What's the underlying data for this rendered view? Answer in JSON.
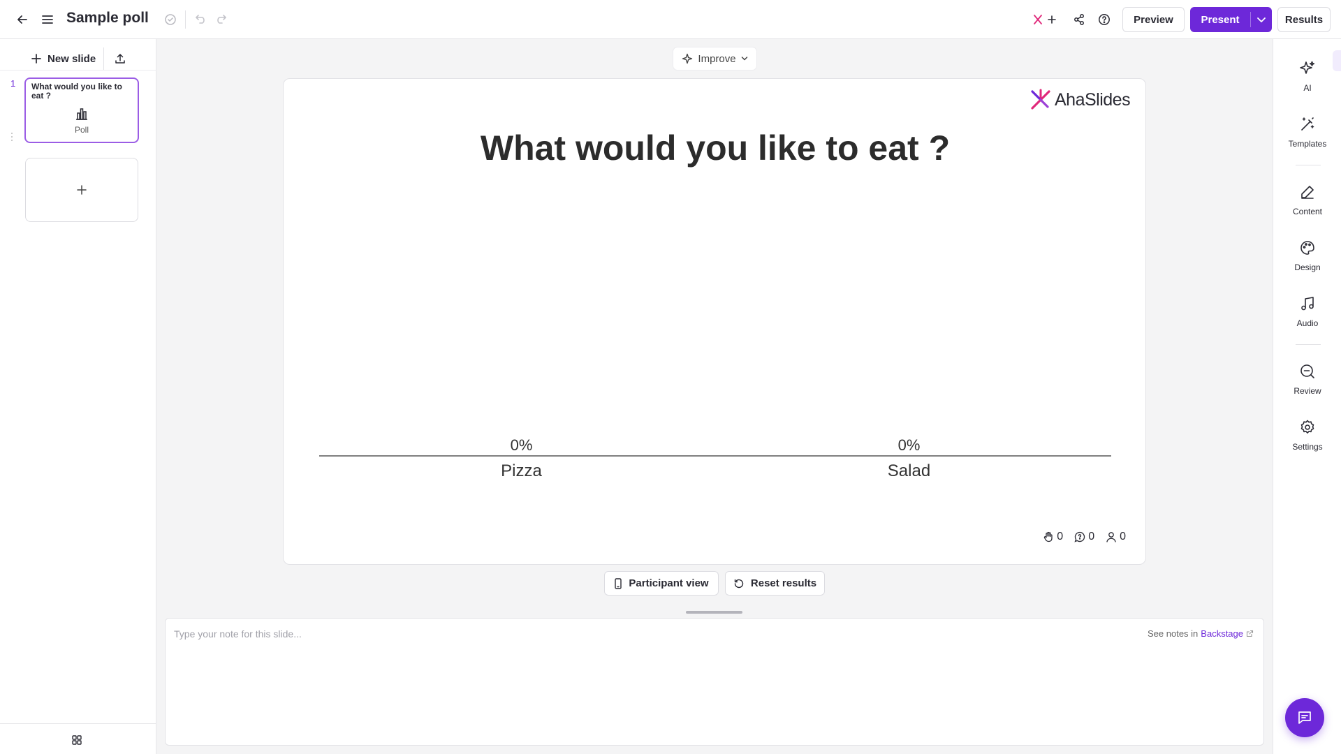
{
  "header": {
    "title": "Sample poll",
    "preview_label": "Preview",
    "present_label": "Present",
    "results_label": "Results"
  },
  "sidebar": {
    "new_slide_label": "New slide",
    "slides": [
      {
        "number": "1",
        "title": "What would you like to eat ?",
        "type": "Poll"
      }
    ]
  },
  "toolbar": {
    "improve_label": "Improve"
  },
  "slide": {
    "brand": "AhaSlides",
    "question": "What would you like to eat ?",
    "counters": {
      "reactions": "0",
      "questions": "0",
      "participants": "0"
    }
  },
  "chart_data": {
    "type": "bar",
    "categories": [
      "Pizza",
      "Salad"
    ],
    "values": [
      0,
      0
    ],
    "value_labels": [
      "0%",
      "0%"
    ],
    "unit": "%",
    "ylim": [
      0,
      100
    ],
    "grid": false
  },
  "actions": {
    "participant_view_label": "Participant view",
    "reset_results_label": "Reset results"
  },
  "notes": {
    "placeholder": "Type your note for this slide...",
    "see_notes_prefix": "See notes in",
    "backstage_link": "Backstage"
  },
  "right_panel": {
    "items": [
      {
        "label": "AI",
        "icon": "sparkle-icon"
      },
      {
        "label": "Templates",
        "icon": "magic-wand-icon"
      },
      {
        "label": "Content",
        "icon": "pencil-icon"
      },
      {
        "label": "Design",
        "icon": "palette-icon"
      },
      {
        "label": "Audio",
        "icon": "music-note-icon"
      },
      {
        "label": "Review",
        "icon": "review-search-icon"
      },
      {
        "label": "Settings",
        "icon": "gear-icon"
      }
    ]
  },
  "colors": {
    "accent": "#6d28d9",
    "thumb_border": "#9b5de5",
    "logo_pink": "#e0287a",
    "logo_purple": "#6d28d9"
  }
}
